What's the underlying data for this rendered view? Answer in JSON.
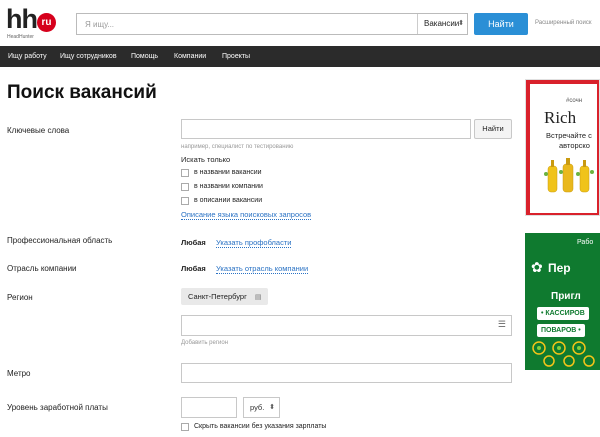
{
  "header": {
    "logo_text": "hh",
    "logo_badge": "ru",
    "logo_sub": "HeadHunter",
    "search_placeholder": "Я ищу...",
    "search_scope": "Вакансии",
    "search_button": "Найти",
    "advanced_link": "Расширенный поиск"
  },
  "nav": {
    "items": [
      "Ищу работу",
      "Ищу сотрудников",
      "Помощь",
      "Компании",
      "Проекты"
    ]
  },
  "main": {
    "title": "Поиск вакансий",
    "keywords": {
      "label": "Ключевые слова",
      "value": "",
      "button": "Найти",
      "hint": "например, специалист по тестированию",
      "search_only_label": "Искать только",
      "options": [
        "в названии вакансии",
        "в названии компании",
        "в описании вакансии"
      ],
      "lang_link": "Описание языка поисковых запросов"
    },
    "prof_area": {
      "label": "Профессиональная область",
      "value": "Любая",
      "link": "Указать профобласти"
    },
    "industry": {
      "label": "Отрасль компании",
      "value": "Любая",
      "link": "Указать отрасль компании"
    },
    "region": {
      "label": "Регион",
      "selected": "Санкт-Петербург",
      "hint": "Добавить регион"
    },
    "metro": {
      "label": "Метро"
    },
    "salary": {
      "label": "Уровень заработной платы",
      "currency": "руб.",
      "hide_label": "Скрыть вакансии без указания зарплаты"
    }
  },
  "ads": {
    "ad1": {
      "hashtag": "#сочн",
      "brand": "Rich",
      "line1": "Встречайте с",
      "line2": "авторско"
    },
    "ad2": {
      "top": "Рабо",
      "brand": "Пер",
      "line1": "Пригл",
      "line2": "• КАССИРОВ",
      "line3": "ПОВАРОВ •"
    }
  },
  "colors": {
    "accent": "#2a8fd6",
    "nav_bg": "#2b2b2b",
    "logo_red": "#d6001c",
    "link": "#2a72c4",
    "ad_green": "#0f7a2f"
  }
}
